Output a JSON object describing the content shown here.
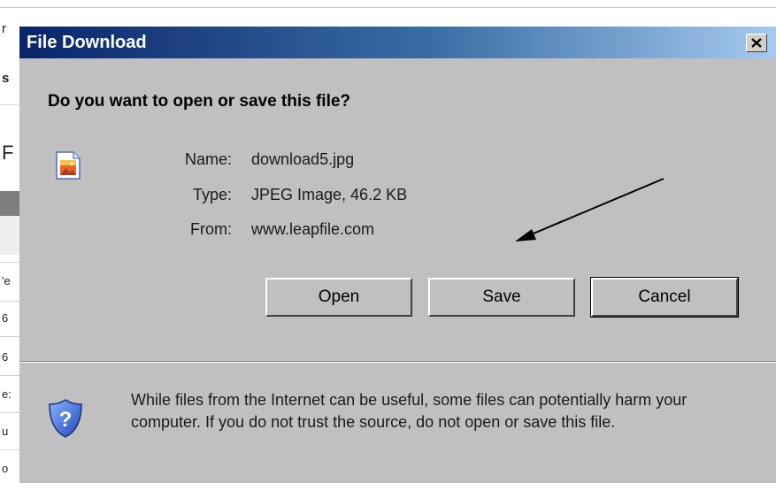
{
  "background": {
    "edge_chars": [
      "r",
      "s",
      "F",
      "'e",
      "6",
      "6",
      "e:",
      "u",
      "o"
    ]
  },
  "dialog": {
    "title": "File Download",
    "question": "Do you want to open or save this file?",
    "file": {
      "name_label": "Name:",
      "name_value": "download5.jpg",
      "type_label": "Type:",
      "type_value": "JPEG Image, 46.2 KB",
      "from_label": "From:",
      "from_value": "www.leapfile.com"
    },
    "buttons": {
      "open": "Open",
      "save": "Save",
      "cancel": "Cancel"
    },
    "warning": "While files from the Internet can be useful, some files can potentially harm your computer. If you do not trust the source, do not open or save this file.",
    "colors": {
      "titlebar_start": "#0a246a",
      "titlebar_end": "#a6caf0",
      "dialog_face": "#c0c0c0"
    },
    "icons": [
      "close-icon",
      "image-file-icon",
      "security-shield-icon",
      "annotation-arrow"
    ]
  }
}
